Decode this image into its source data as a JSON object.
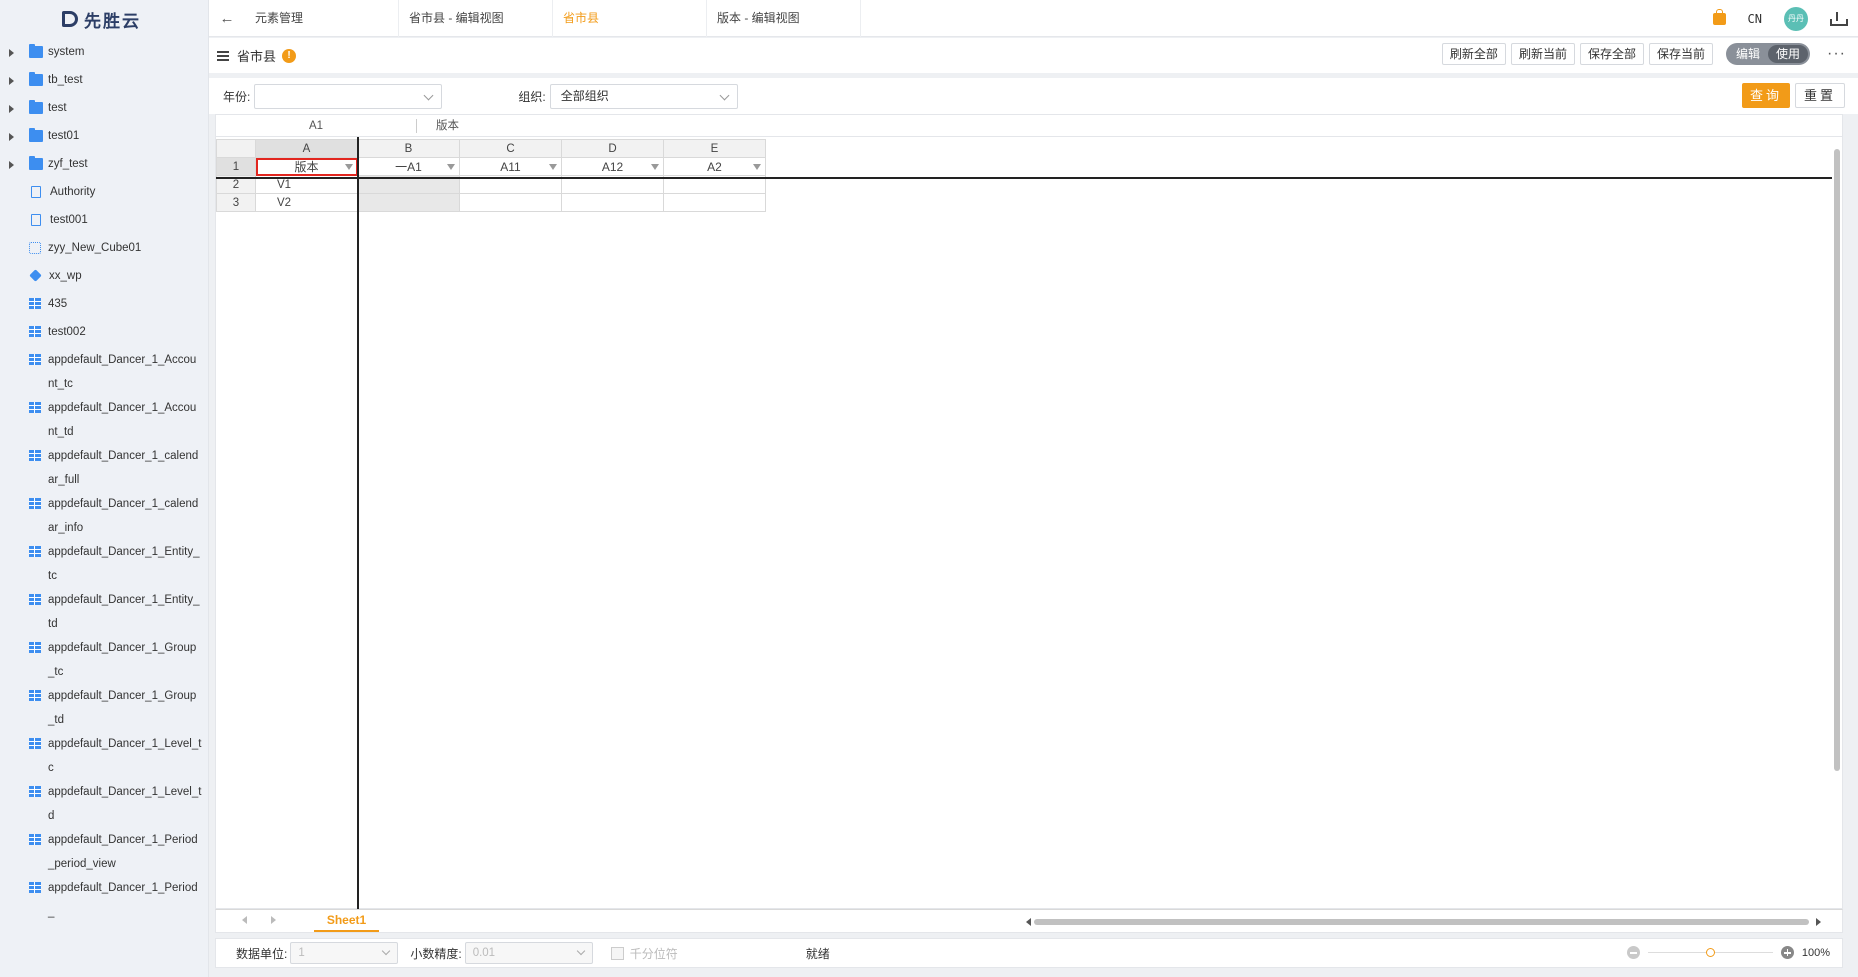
{
  "app": {
    "logo_text": "先胜云"
  },
  "sidebar": {
    "items": [
      {
        "label": "system",
        "icon": "folder-icon",
        "expandable": true
      },
      {
        "label": "tb_test",
        "icon": "folder-icon",
        "expandable": true
      },
      {
        "label": "test",
        "icon": "folder-icon",
        "expandable": true
      },
      {
        "label": "test01",
        "icon": "folder-icon",
        "expandable": true
      },
      {
        "label": "zyf_test",
        "icon": "folder-icon",
        "expandable": true
      },
      {
        "label": "Authority",
        "icon": "document-icon",
        "expandable": false
      },
      {
        "label": "test001",
        "icon": "document-icon",
        "expandable": false
      },
      {
        "label": "zyy_New_Cube01",
        "icon": "network-icon",
        "expandable": false
      },
      {
        "label": "xx_wp",
        "icon": "cube-icon",
        "expandable": false
      },
      {
        "label": "435",
        "icon": "table-icon",
        "expandable": false
      },
      {
        "label": "test002",
        "icon": "table-icon",
        "expandable": false
      },
      {
        "label": "appdefault_Dancer_1_Account_tc",
        "icon": "table-icon",
        "expandable": false
      },
      {
        "label": "appdefault_Dancer_1_Account_td",
        "icon": "table-icon",
        "expandable": false
      },
      {
        "label": "appdefault_Dancer_1_calendar_full",
        "icon": "table-icon",
        "expandable": false
      },
      {
        "label": "appdefault_Dancer_1_calendar_info",
        "icon": "table-icon",
        "expandable": false
      },
      {
        "label": "appdefault_Dancer_1_Entity_tc",
        "icon": "table-icon",
        "expandable": false
      },
      {
        "label": "appdefault_Dancer_1_Entity_td",
        "icon": "table-icon",
        "expandable": false
      },
      {
        "label": "appdefault_Dancer_1_Group_tc",
        "icon": "table-icon",
        "expandable": false
      },
      {
        "label": "appdefault_Dancer_1_Group_td",
        "icon": "table-icon",
        "expandable": false
      },
      {
        "label": "appdefault_Dancer_1_Level_tc",
        "icon": "table-icon",
        "expandable": false
      },
      {
        "label": "appdefault_Dancer_1_Level_td",
        "icon": "table-icon",
        "expandable": false
      },
      {
        "label": "appdefault_Dancer_1_Period_period_view",
        "icon": "table-icon",
        "expandable": false
      },
      {
        "label": "appdefault_Dancer_1_Period_",
        "icon": "table-icon",
        "expandable": false
      }
    ]
  },
  "tabs": [
    {
      "label": "元素管理",
      "active": false
    },
    {
      "label": "省市县 - 编辑视图",
      "active": false
    },
    {
      "label": "省市县",
      "active": true
    },
    {
      "label": "版本 - 编辑视图",
      "active": false
    }
  ],
  "topbar": {
    "lang": "CN",
    "avatar_text": "丹丹"
  },
  "toolbar": {
    "title": "省市县",
    "info": "!",
    "refresh_all": "刷新全部",
    "refresh_current": "刷新当前",
    "save_all": "保存全部",
    "save_current": "保存当前",
    "mode_edit": "编辑",
    "mode_use": "使用",
    "more": "···"
  },
  "filters": {
    "year_label": "年份:",
    "year_value": "",
    "org_label": "组织:",
    "org_value": "全部组织",
    "query": "查询",
    "reset": "重置"
  },
  "formula_bar": {
    "cell_ref": "A1",
    "value": "版本"
  },
  "spreadsheet": {
    "columns": [
      "A",
      "B",
      "C",
      "D",
      "E"
    ],
    "rows": [
      "1",
      "2",
      "3"
    ],
    "header_cells": [
      "版本",
      "一A1",
      "A11",
      "A12",
      "A2"
    ],
    "row2": [
      "V1",
      "",
      "",
      "",
      ""
    ],
    "row3": [
      "V2",
      "",
      "",
      "",
      ""
    ]
  },
  "sheet_tabs": [
    "Sheet1"
  ],
  "statusbar": {
    "unit_label": "数据单位:",
    "unit_value": "1",
    "precision_label": "小数精度:",
    "precision_value": "0.01",
    "thousands_label": "千分位符",
    "ready": "就绪",
    "zoom": "100%"
  },
  "colors": {
    "accent": "#f29b18",
    "highlight": "#e2261f",
    "folder": "#3d8ef0"
  }
}
